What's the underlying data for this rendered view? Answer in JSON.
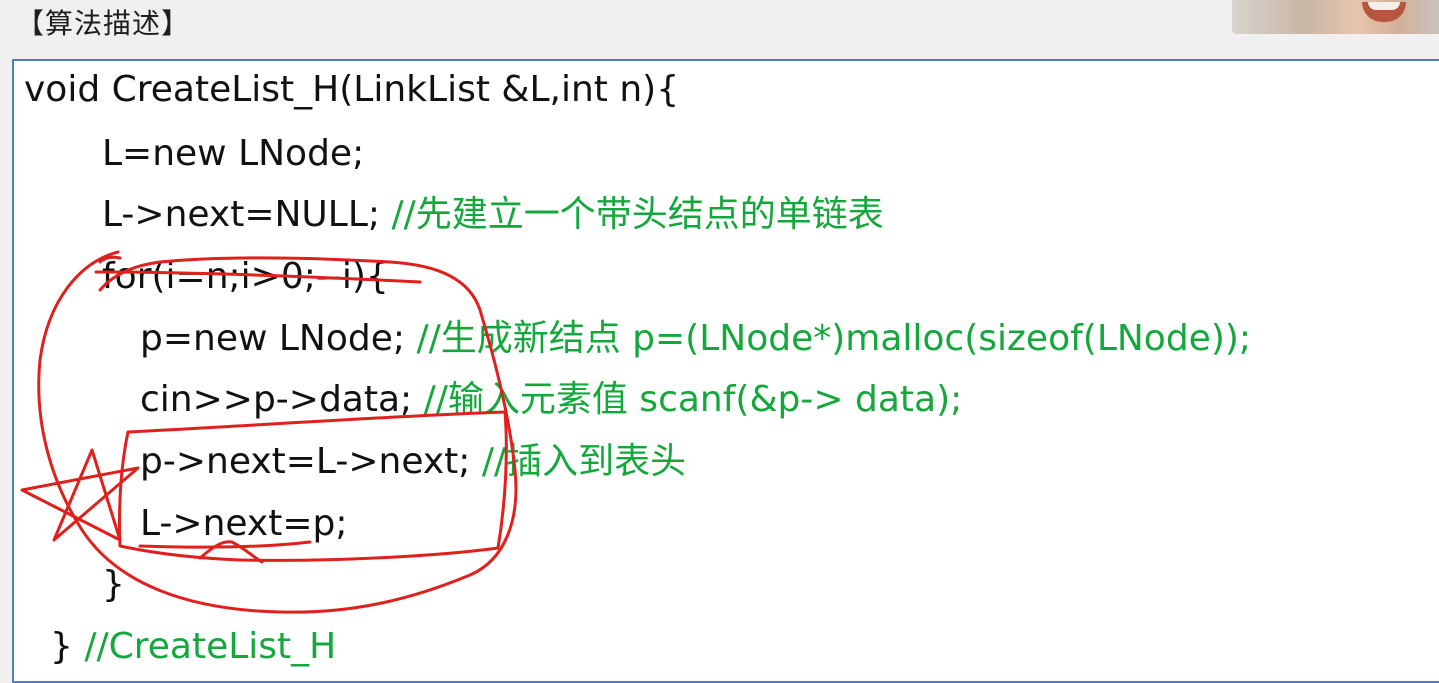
{
  "heading": "【算法描述】",
  "code_lines": [
    {
      "code": "void CreateList_H(LinkList &L,int n){",
      "comment": ""
    },
    {
      "code": "L=new LNode;",
      "comment": ""
    },
    {
      "code": "L->next=NULL; ",
      "comment": "//先建立一个带头结点的单链表"
    },
    {
      "code": "for(i=n;i>0;--i){",
      "comment": ""
    },
    {
      "code": "p=new LNode; ",
      "comment": "//生成新结点 p=(LNode*)malloc(sizeof(LNode));"
    },
    {
      "code": "cin>>p->data; ",
      "comment": "//输入元素值 scanf(&p-> data);"
    },
    {
      "code": "p->next=L->next;",
      "comment": "        //插入到表头"
    },
    {
      "code": "L->next=p;",
      "comment": ""
    },
    {
      "code": "}",
      "comment": ""
    },
    {
      "code": "} ",
      "comment": "//CreateList_H"
    }
  ],
  "colors": {
    "code_text": "#111111",
    "comment_text": "#14a83c",
    "box_border": "#4f7fbd",
    "annotation_ink": "#e0201c"
  }
}
